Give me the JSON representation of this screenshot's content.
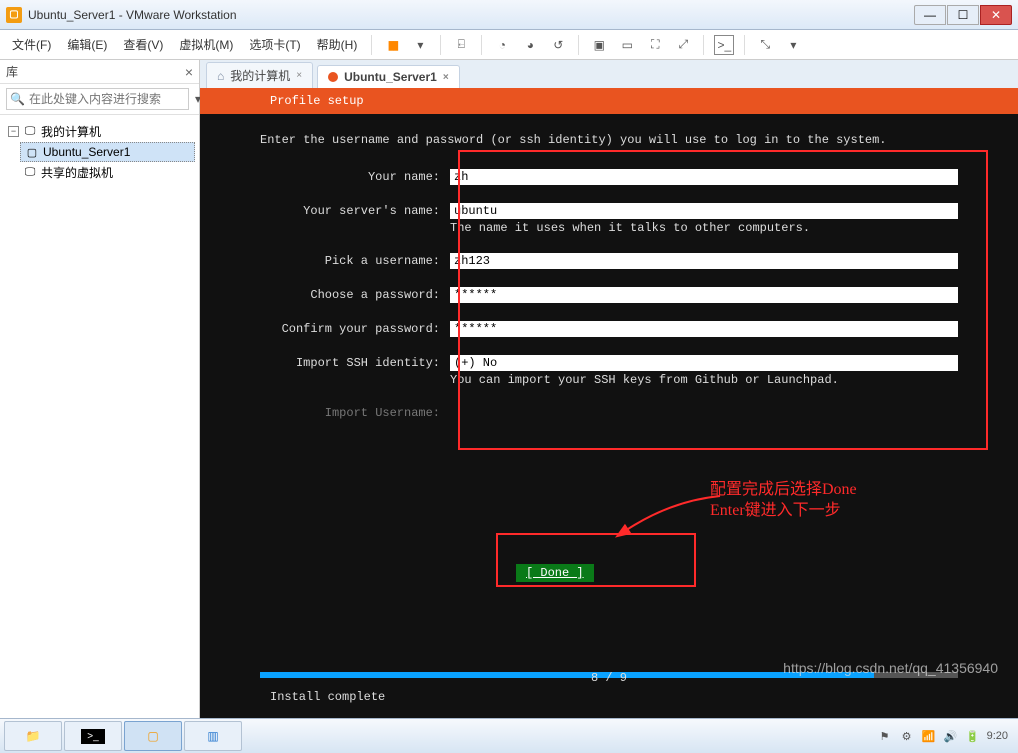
{
  "window": {
    "title": "Ubuntu_Server1 - VMware Workstation"
  },
  "menus": {
    "file": "文件(F)",
    "edit": "编辑(E)",
    "view": "查看(V)",
    "vm": "虚拟机(M)",
    "tabs": "选项卡(T)",
    "help": "帮助(H)"
  },
  "sidebar": {
    "title": "库",
    "search_placeholder": "在此处键入内容进行搜索",
    "root": "我的计算机",
    "node_selected": "Ubuntu_Server1",
    "node_shared": "共享的虚拟机"
  },
  "tabs": {
    "home": "我的计算机",
    "vm": "Ubuntu_Server1"
  },
  "installer": {
    "heading": "Profile setup",
    "intro": "Enter the username and password (or ssh identity) you will use to log in to the system.",
    "labels": {
      "name": "Your name:",
      "server": "Your server's name:",
      "username": "Pick a username:",
      "password": "Choose a password:",
      "confirm": "Confirm your password:",
      "ssh": "Import SSH identity:",
      "import_user": "Import Username:"
    },
    "values": {
      "name": "zh",
      "server": "ubuntu",
      "username": "zh123",
      "password": "******",
      "confirm": "******",
      "ssh": "(+) No"
    },
    "hints": {
      "server": "The name it uses when it talks to other computers.",
      "ssh": "You can import your SSH keys from Github or Launchpad."
    },
    "done": "[ Done       ]",
    "progress": "8 / 9",
    "status": "Install complete"
  },
  "annotation": {
    "line1": "配置完成后选择Done",
    "line2": "Enter键进入下一步"
  },
  "watermark": "https://blog.csdn.net/qq_41356940",
  "systray": {
    "time": "9:20"
  }
}
